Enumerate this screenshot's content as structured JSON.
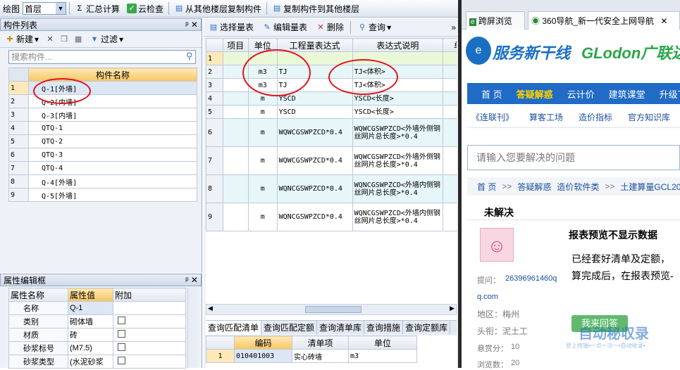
{
  "toolbar": {
    "draw": "绘图",
    "floor": "首层",
    "sum_calc": "汇总计算",
    "cloud_check": "云检查",
    "copy_from": "从其他楼层复制构件",
    "copy_to": "复制构件到其他楼层"
  },
  "component_list": {
    "title": "构件列表",
    "new": "新建",
    "filter": "过滤",
    "search_placeholder": "搜索构件...",
    "header": "构件名称",
    "items": [
      {
        "n": "1",
        "name": "Q-1[外墙]"
      },
      {
        "n": "2",
        "name": "Q-2[内墙]"
      },
      {
        "n": "3",
        "name": "Q-3[内墙]"
      },
      {
        "n": "4",
        "name": "QTQ-1"
      },
      {
        "n": "5",
        "name": "QTQ-2"
      },
      {
        "n": "6",
        "name": "QTQ-3"
      },
      {
        "n": "7",
        "name": "QTQ-4"
      },
      {
        "n": "8",
        "name": "Q-4[外墙]"
      },
      {
        "n": "9",
        "name": "Q-5[外墙]"
      }
    ]
  },
  "property_editor": {
    "title": "属性编辑框",
    "col_name": "属性名称",
    "col_value": "属性值",
    "col_extra": "附加",
    "rows": [
      {
        "n": "名称",
        "v": "Q-1"
      },
      {
        "n": "类别",
        "v": "砌体墙"
      },
      {
        "n": "材质",
        "v": "砖"
      },
      {
        "n": "砂浆标号",
        "v": "(M7.5)"
      },
      {
        "n": "砂浆类型",
        "v": "(水泥砂浆"
      }
    ]
  },
  "quantity_table": {
    "select": "选择量表",
    "edit": "编辑量表",
    "delete": "删除",
    "query": "查询",
    "headers": [
      "项目",
      "单位",
      "工程量表达式",
      "表达式说明",
      "单"
    ],
    "rows": [
      {
        "n": "1",
        "unit": "",
        "expr": "",
        "desc": ""
      },
      {
        "n": "2",
        "unit": "m3",
        "expr": "TJ",
        "desc": "TJ<体积>"
      },
      {
        "n": "3",
        "unit": "m3",
        "expr": "TJ",
        "desc": "TJ<体积>"
      },
      {
        "n": "4",
        "unit": "m",
        "expr": "YSCD",
        "desc": "YSCD<长度>"
      },
      {
        "n": "5",
        "unit": "m",
        "expr": "YSCD",
        "desc": "YSCD<长度>"
      },
      {
        "n": "6",
        "unit": "m",
        "expr": "WQWCGSWPZCD*0.4",
        "desc": "WQWCGSWPZCD<外墙外侧钢丝网片总长度>*0.4"
      },
      {
        "n": "7",
        "unit": "m",
        "expr": "WQWCGSWPZCD*0.4",
        "desc": "WQWCGSWPZCD<外墙外侧钢丝网片总长度>*0.4"
      },
      {
        "n": "8",
        "unit": "m",
        "expr": "WQNCGSWPZCD*0.4",
        "desc": "WQNCGSWPZCD<外墙内侧钢丝网片总长度>*0.4"
      },
      {
        "n": "9",
        "unit": "m",
        "expr": "WQNCGSWPZCD*0.4",
        "desc": "WQNCGSWPZCD<外墙内侧钢丝网片总长度>*0.4"
      }
    ]
  },
  "bottom_tabs": [
    "查询匹配清单",
    "查询匹配定额",
    "查询清单库",
    "查询措施",
    "查询定额库"
  ],
  "match_table": {
    "headers": [
      "编码",
      "清单项",
      "单位"
    ],
    "rows": [
      {
        "n": "1",
        "code": "010401003",
        "item": "实心砖墙",
        "unit": "m3"
      }
    ]
  },
  "browser": {
    "tab1": "跨屏浏览",
    "tab2": "360导航_新一代安全上网导航",
    "logo_text": "服务新干线",
    "brand": "GLodon广联达",
    "nav": [
      "首 页",
      "答疑解惑",
      "云计价",
      "建筑课堂",
      "升级下载"
    ],
    "subnav": [
      "《连联刊》",
      "算客工场",
      "造价指标",
      "官方知识库"
    ],
    "search_placeholder": "请输入您要解决的问题",
    "breadcrumb": [
      "首 页",
      ">>",
      "答疑解惑",
      "造价软件类",
      ">>",
      "土建算量GCL2013"
    ],
    "status": "未解决",
    "question_title": "报表预览不显示数据",
    "question_body1": "已经套好清单及定额，",
    "question_body2": "算完成后，在报表预览-",
    "asker_label": "提问：",
    "asker": "26396961460q",
    "asker_cont": "q.com",
    "region_label": "地区：",
    "region": "梅州",
    "title_label": "头衔：",
    "title": "泥土工",
    "bounty_label": "悬赏分：",
    "bounty": "10",
    "views_label": "浏览数：",
    "views": "20",
    "answer_btn": "我来回答",
    "watermark1": "自动秘収录",
    "watermark2": "登上榜端•一点一次一•自动收录•"
  }
}
